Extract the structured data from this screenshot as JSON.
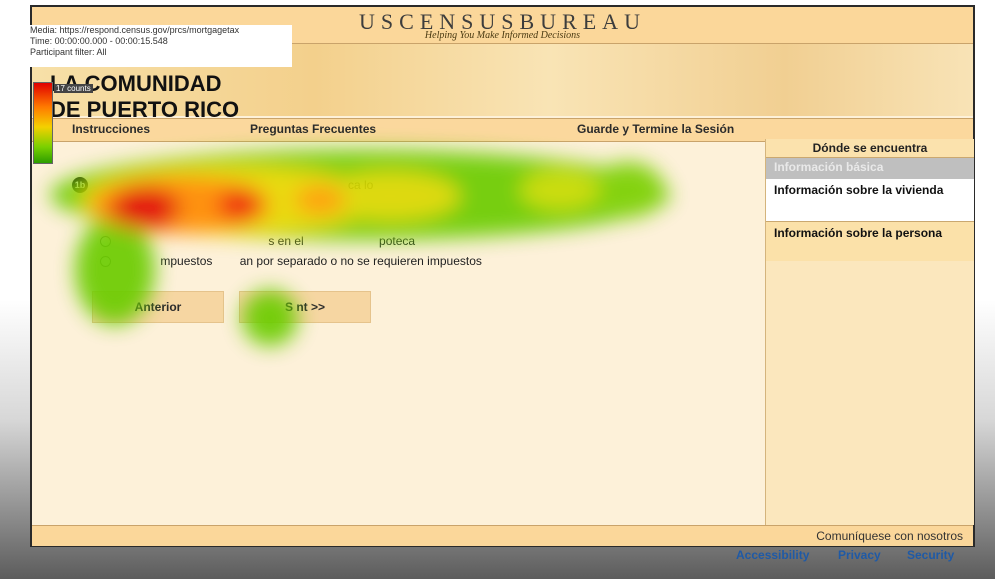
{
  "overlay": {
    "media": "Media: https://respond.census.gov/prcs/mortgagetax",
    "time": "Time: 00:00:00.000 - 00:00:15.548",
    "participant": "Participant filter: All",
    "legend_counts": "17 counts",
    "heatmap_colors": [
      "#e00000",
      "#ff7a00",
      "#f4d000",
      "#7ad000",
      "#2d9d00"
    ]
  },
  "header": {
    "title": "USCENSUSBUREAU",
    "tagline": "Helping You Make Informed Decisions"
  },
  "brand": {
    "line1": "LA COMUNIDAD",
    "line2": "DE PUERTO RICO"
  },
  "nav": {
    "instructions": "Instrucciones",
    "faq": "Preguntas Frecuentes",
    "save_exit": "Guarde y Termine la Sesión"
  },
  "sidebar": {
    "heading": "Dónde se encuentra",
    "items": [
      {
        "label": "Información básica",
        "state": "disabled"
      },
      {
        "label": "Información sobre la vivienda",
        "state": "current"
      },
      {
        "label": "Información sobre la persona",
        "state": "default"
      }
    ]
  },
  "question": {
    "number": "1b",
    "text_fragment": "ca lo",
    "options": [
      {
        "text": "s en el",
        "text2": "poteca"
      },
      {
        "text": "mpuestos",
        "text2": "an por separado o no se requieren impuestos"
      }
    ]
  },
  "buttons": {
    "previous": "Anterior",
    "next": "S   nt   >>"
  },
  "footer": {
    "contact": "Comuníquese con nosotros",
    "accessibility": "Accessibility",
    "privacy": "Privacy",
    "security": "Security"
  },
  "colors": {
    "header": "#fbd79a",
    "page": "#fdf1d9",
    "sidebar": "#fbe7bd",
    "link": "#1f5aa6"
  }
}
